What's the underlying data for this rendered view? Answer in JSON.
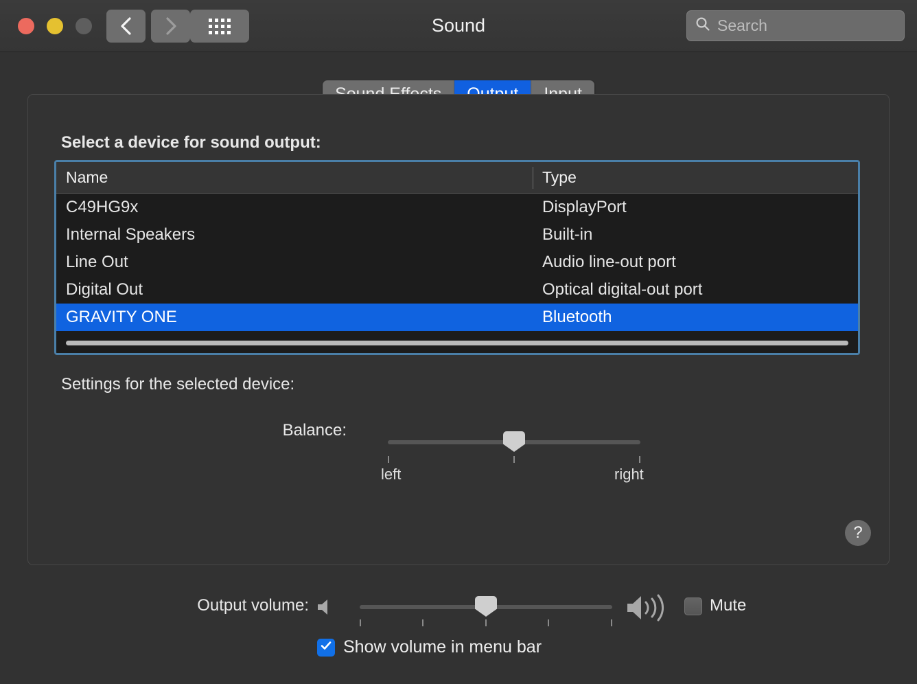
{
  "window": {
    "title": "Sound",
    "traffic_lights": [
      "close",
      "minimize",
      "zoom"
    ],
    "nav": {
      "back_icon": "chevron-left-icon",
      "forward_icon": "chevron-right-icon",
      "grid_icon": "grid-dots-icon"
    },
    "search": {
      "placeholder": "Search",
      "icon": "search-icon"
    }
  },
  "tabs": [
    {
      "label": "Sound Effects",
      "active": false
    },
    {
      "label": "Output",
      "active": true
    },
    {
      "label": "Input",
      "active": false
    }
  ],
  "main": {
    "section_label": "Select a device for sound output:",
    "settings_label": "Settings for the selected device:",
    "help_label": "?"
  },
  "device_table": {
    "columns": [
      "Name",
      "Type"
    ],
    "rows": [
      {
        "name": "C49HG9x",
        "type": "DisplayPort",
        "selected": false
      },
      {
        "name": "Internal Speakers",
        "type": "Built-in",
        "selected": false
      },
      {
        "name": "Line Out",
        "type": "Audio line-out port",
        "selected": false
      },
      {
        "name": "Digital Out",
        "type": "Optical digital-out port",
        "selected": false
      },
      {
        "name": "GRAVITY ONE",
        "type": "Bluetooth",
        "selected": true
      }
    ]
  },
  "balance": {
    "label": "Balance:",
    "left_label": "left",
    "right_label": "right",
    "value_percent": 50
  },
  "output_volume": {
    "label": "Output volume:",
    "value_percent": 50,
    "low_icon": "speaker-low-icon",
    "high_icon": "speaker-high-icon",
    "mute_label": "Mute",
    "mute_checked": false
  },
  "show_volume": {
    "label": "Show volume in menu bar",
    "checked": true
  },
  "colors": {
    "accent_blue": "#1063e0",
    "window_bg": "#323232",
    "panel_bg": "#333333",
    "table_bg": "#1c1c1c",
    "focus_ring": "#4a7fa8",
    "close_red": "#ec6a5e",
    "min_yellow": "#e5c130",
    "zoom_gray": "#5e5e5e"
  }
}
